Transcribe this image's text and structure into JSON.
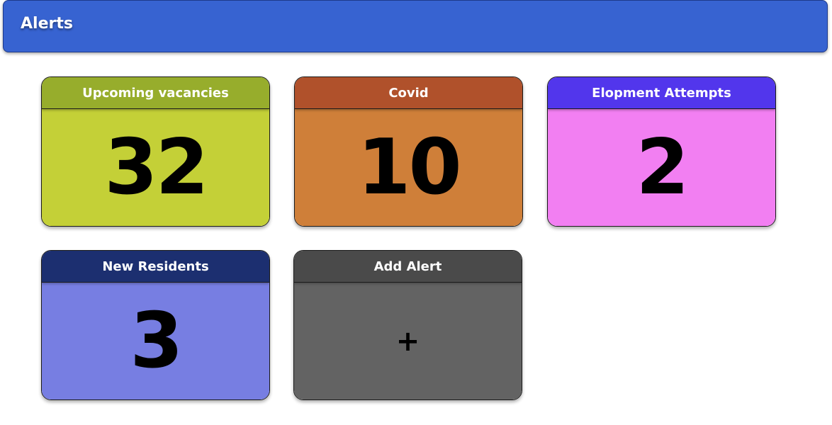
{
  "header": {
    "title": "Alerts"
  },
  "cards": [
    {
      "title": "Upcoming vacancies",
      "value": "32",
      "head_color": "#97ad2c",
      "body_color": "#c4d037"
    },
    {
      "title": "Covid",
      "value": "10",
      "head_color": "#b0512b",
      "body_color": "#cf7f39"
    },
    {
      "title": "Elopment Attempts",
      "value": "2",
      "head_color": "#5236ec",
      "body_color": "#f27ff2"
    },
    {
      "title": "New Residents",
      "value": "3",
      "head_color": "#1c2f70",
      "body_color": "#777ee2"
    }
  ],
  "add_card": {
    "title": "Add Alert",
    "icon_glyph": "+",
    "icon": "plus-icon",
    "head_color": "#4a4a4a",
    "body_color": "#636363"
  }
}
